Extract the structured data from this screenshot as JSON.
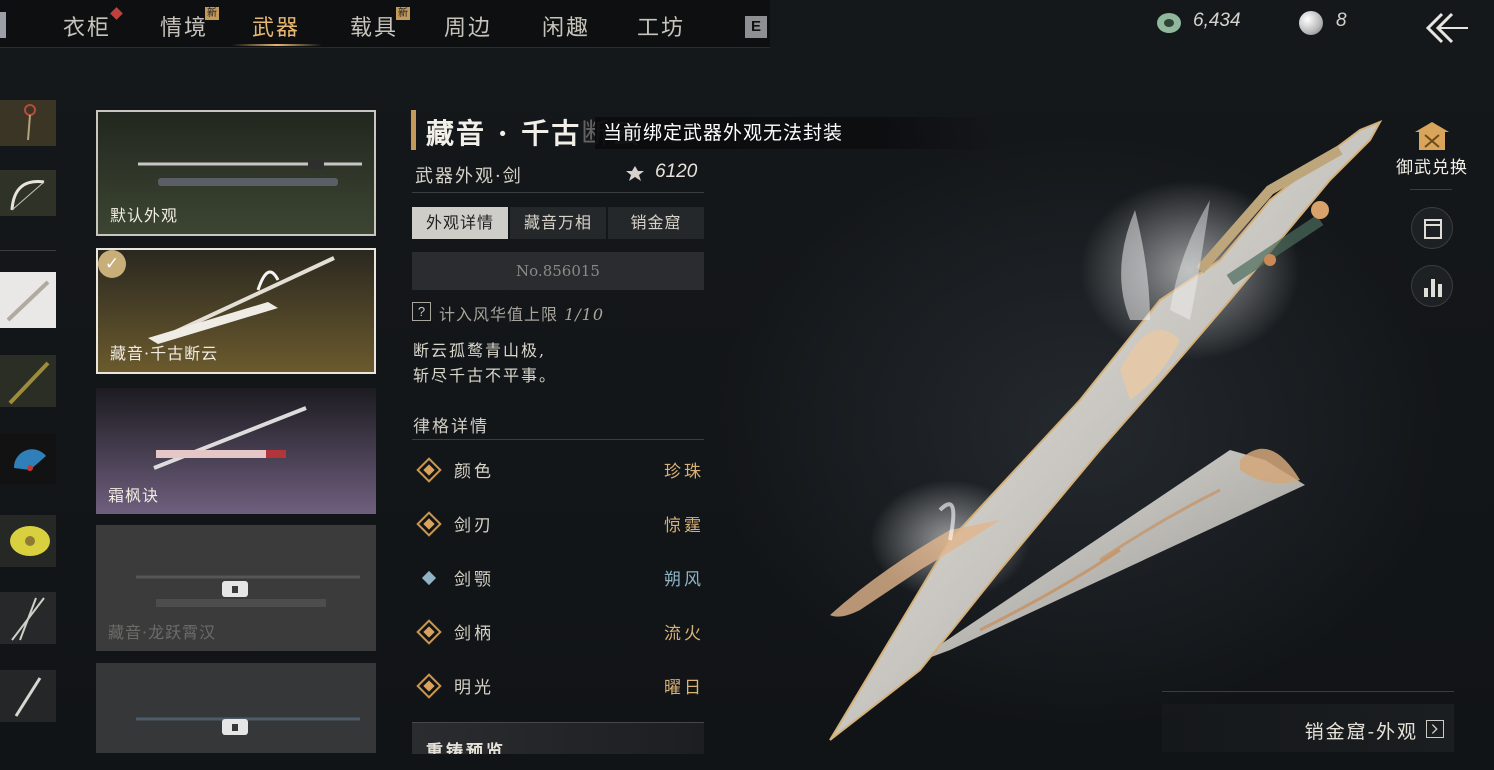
{
  "nav": {
    "tabs": [
      {
        "label": "衣柜",
        "active": false
      },
      {
        "label": "情境",
        "active": false,
        "badge": "新"
      },
      {
        "label": "武器",
        "active": true
      },
      {
        "label": "载具",
        "active": false,
        "badge": "新"
      },
      {
        "label": "周边",
        "active": false
      },
      {
        "label": "闲趣",
        "active": false
      },
      {
        "label": "工坊",
        "active": false
      }
    ],
    "hotkey": "E"
  },
  "currency": {
    "jade": "6,434",
    "pearl": "8"
  },
  "weapon_list": [
    {
      "label": "默认外观",
      "state": "owned"
    },
    {
      "label": "藏音·千古断云",
      "state": "selected"
    },
    {
      "label": "霜枫诀",
      "state": "owned"
    },
    {
      "label": "藏音·龙跃霄汉",
      "state": "locked"
    },
    {
      "label": "",
      "state": "locked"
    }
  ],
  "detail": {
    "title_visible": "藏音 · 千古",
    "title_faded": "断云",
    "toast": "当前绑定武器外观无法封装",
    "subtitle": "武器外观·剑",
    "score": "6120",
    "subtabs": [
      "外观详情",
      "藏音万相",
      "销金窟"
    ],
    "active_subtab": 0,
    "serial": "No.856015",
    "limit_label": "计入风华值上限",
    "limit_value": "1/10",
    "poem_line1": "断云孤鹜青山极,",
    "poem_line2": "斩尽千古不平事。",
    "section_title": "律格详情",
    "attributes": [
      {
        "name": "颜色",
        "value": "珍珠",
        "color": "#d8b277"
      },
      {
        "name": "剑刃",
        "value": "惊霆",
        "color": "#d8b277"
      },
      {
        "name": "剑颚",
        "value": "朔风",
        "color": "#8fb4c6"
      },
      {
        "name": "剑柄",
        "value": "流火",
        "color": "#d8b277"
      },
      {
        "name": "明光",
        "value": "曜日",
        "color": "#d8b277"
      }
    ],
    "preview_label": "重铸预览"
  },
  "side": {
    "exchange_label": "御武兑换",
    "bottom_button": "销金窟-外观"
  },
  "colors": {
    "accent_gold": "#e7b672",
    "attr_gold": "#d8b277",
    "attr_blue": "#8fb4c6"
  }
}
